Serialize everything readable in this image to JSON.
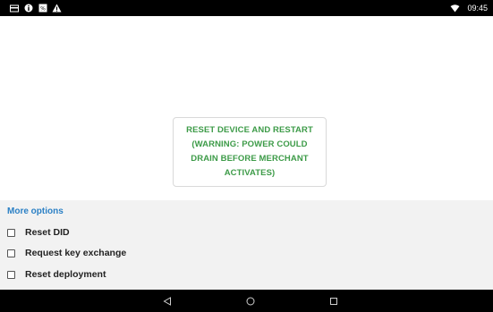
{
  "status_bar": {
    "icons": [
      "card-icon",
      "info-icon",
      "badge-icon",
      "warning-icon"
    ],
    "signal_icon": "wifi-icon",
    "time": "09:45"
  },
  "main": {
    "reset_button_label": "RESET DEVICE AND RESTART\n(WARNING: POWER COULD\nDRAIN BEFORE MERCHANT\nACTIVATES)",
    "accent_color": "#3d9b48"
  },
  "options": {
    "header": "More options",
    "header_color": "#2b80c5",
    "items": [
      {
        "label": "Reset DID",
        "checked": false
      },
      {
        "label": "Request key exchange",
        "checked": false
      },
      {
        "label": "Reset deployment",
        "checked": false
      }
    ]
  },
  "nav_bar": {
    "buttons": [
      "back-icon",
      "home-icon",
      "recents-icon"
    ]
  }
}
